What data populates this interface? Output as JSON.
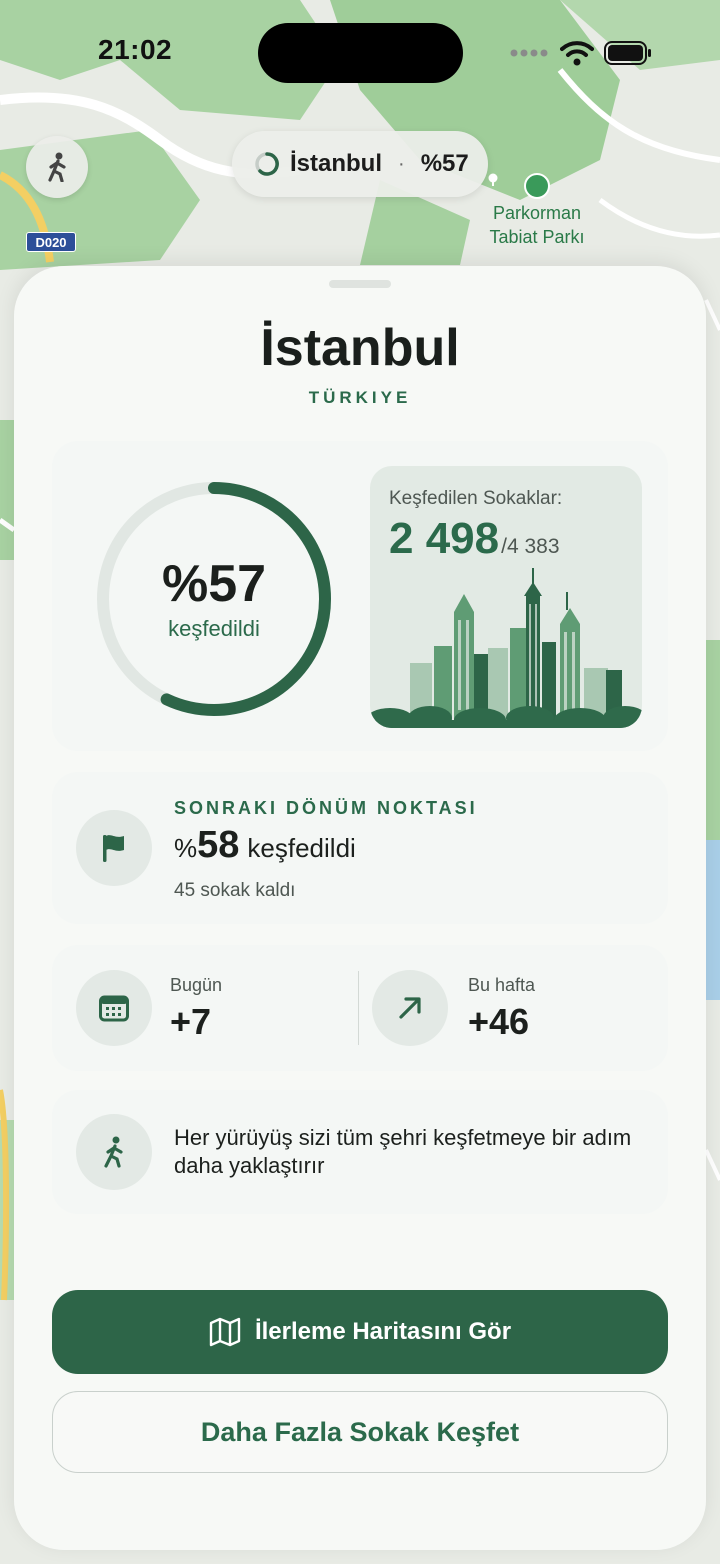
{
  "status_bar": {
    "time": "21:02"
  },
  "map": {
    "pill_city": "İstanbul",
    "pill_separator": "·",
    "pill_percent": "%57",
    "poi_name": "Parkorman Tabiat Parkı",
    "road_label": "D020",
    "colors": {
      "park": "#a9d3a4",
      "land": "#e7ebe4",
      "road": "#ffffff",
      "highway": "#f3cf63"
    }
  },
  "sheet": {
    "title": "İstanbul",
    "subtitle": "TÜRKIYE"
  },
  "progress": {
    "percent_label": "%57",
    "percent_value": 0.57,
    "caption": "keşfedildi",
    "streets_label": "Keşfedilen Sokaklar:",
    "streets_explored": "2 498",
    "streets_total": "/4 383"
  },
  "milestone": {
    "heading": "SONRAKI DÖNÜM NOKTASI",
    "prefix": "%",
    "number": "58",
    "label": "keşfedildi",
    "remaining": "45 sokak kaldı",
    "icon": "flag-icon"
  },
  "stats": {
    "today_label": "Bugün",
    "today_value": "+7",
    "today_icon": "calendar-icon",
    "week_label": "Bu hafta",
    "week_value": "+46",
    "week_icon": "arrow-up-right-icon"
  },
  "tip": {
    "text": "Her yürüyüş sizi tüm şehri keşfetmeye bir adım daha yaklaştırır",
    "icon": "walking-icon"
  },
  "buttons": {
    "primary_label": "İlerleme Haritasını Gör",
    "primary_icon": "map-icon",
    "secondary_label": "Daha Fazla Sokak Keşfet"
  },
  "theme": {
    "accent": "#2d6548",
    "accent_text": "#2b6a4b",
    "ring_track": "#e1e7e3"
  }
}
